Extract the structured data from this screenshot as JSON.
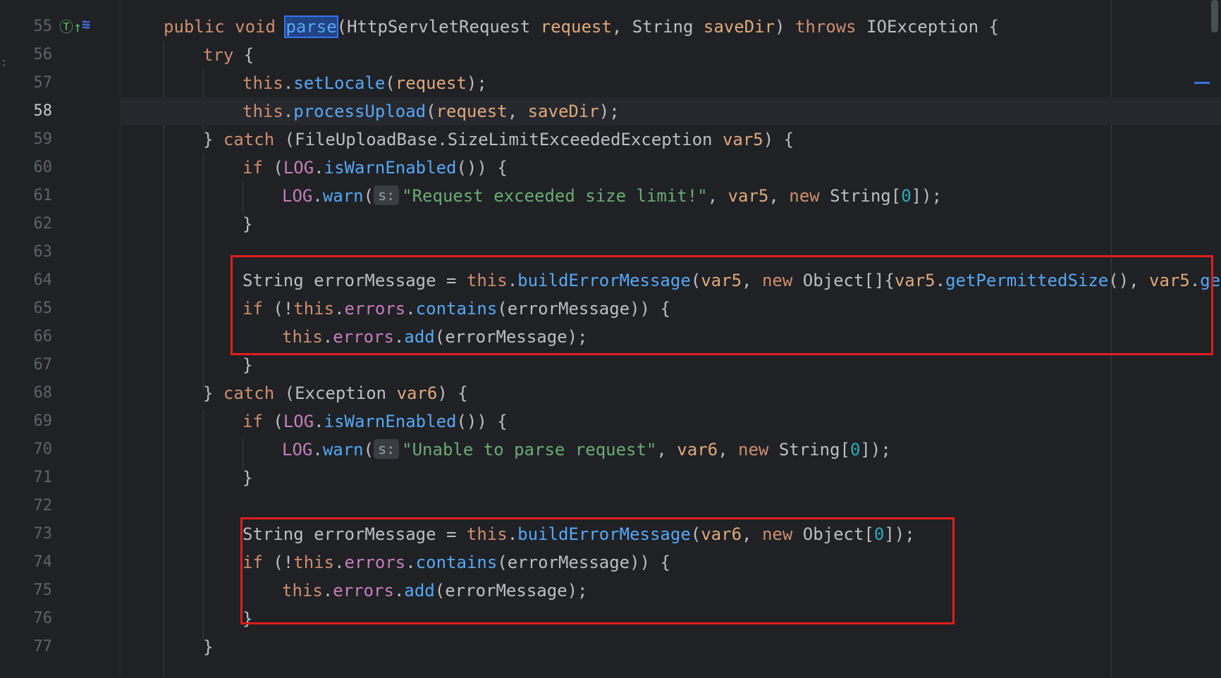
{
  "editor": {
    "colors": {
      "background": "#1f2125",
      "keyword": "#cf8e6d",
      "method": "#56a8f5",
      "string": "#6aab73",
      "field": "#c77dbb",
      "highlight": "#e21c1c"
    },
    "gutter_icons": {
      "implements": "implements-icon",
      "override": "override-icon"
    },
    "param_hint": "s:",
    "lines": [
      {
        "num": "55"
      },
      {
        "num": "56"
      },
      {
        "num": "57"
      },
      {
        "num": "58"
      },
      {
        "num": "59"
      },
      {
        "num": "60"
      },
      {
        "num": "61"
      },
      {
        "num": "62"
      },
      {
        "num": "63"
      },
      {
        "num": "64"
      },
      {
        "num": "65"
      },
      {
        "num": "66"
      },
      {
        "num": "67"
      },
      {
        "num": "68"
      },
      {
        "num": "69"
      },
      {
        "num": "70"
      },
      {
        "num": "71"
      },
      {
        "num": "72"
      },
      {
        "num": "73"
      },
      {
        "num": "74"
      },
      {
        "num": "75"
      },
      {
        "num": "76"
      },
      {
        "num": "77"
      }
    ],
    "code": {
      "l55": {
        "kw1": "public",
        "kw2": "void",
        "method": "parse",
        "type1": "HttpServletRequest",
        "p1": "request",
        "type2": "String",
        "p2": "saveDir",
        "kw3": "throws",
        "exc": "IOException",
        "tail": " {"
      },
      "l56": {
        "kw": "try",
        "tail": " {"
      },
      "l57": {
        "this": "this",
        "method": "setLocale",
        "arg": "request",
        "tail": ");"
      },
      "l58": {
        "this": "this",
        "method": "processUpload",
        "arg1": "request",
        "arg2": "saveDir",
        "tail": ");"
      },
      "l59": {
        "head": "} ",
        "kw": "catch",
        "type": "FileUploadBase.SizeLimitExceededException",
        "var": "var5",
        "tail": ") {"
      },
      "l60": {
        "kw": "if",
        "obj": "LOG",
        "method": "isWarnEnabled",
        "tail": "()) {"
      },
      "l61": {
        "obj": "LOG",
        "method": "warn",
        "str": "\"Request exceeded size limit!\"",
        "var": "var5",
        "kw": "new",
        "type": "String",
        "num": "0",
        "tail": "]);"
      },
      "l62": {
        "text": "}"
      },
      "l64": {
        "type": "String",
        "var": " errorMessage = ",
        "this": "this",
        "method": "buildErrorMessage",
        "arg": "var5",
        "kw": "new",
        "type2": "Object",
        "arg2": "var5",
        "method2": "getPermittedSize",
        "arg3": "var5",
        "method3": "getA"
      },
      "l65": {
        "kw": "if",
        "this": "this",
        "field": "errors",
        "method": "contains",
        "arg": "errorMessage",
        "tail": ")) {"
      },
      "l66": {
        "this": "this",
        "field": "errors",
        "method": "add",
        "arg": "errorMessage",
        "tail": ");"
      },
      "l67": {
        "text": "}"
      },
      "l68": {
        "head": "} ",
        "kw": "catch",
        "type": "Exception",
        "var": "var6",
        "tail": ") {"
      },
      "l69": {
        "kw": "if",
        "obj": "LOG",
        "method": "isWarnEnabled",
        "tail": "()) {"
      },
      "l70": {
        "obj": "LOG",
        "method": "warn",
        "str": "\"Unable to parse request\"",
        "var": "var6",
        "kw": "new",
        "type": "String",
        "num": "0",
        "tail": "]);"
      },
      "l71": {
        "text": "}"
      },
      "l73": {
        "type": "String",
        "var": " errorMessage = ",
        "this": "this",
        "method": "buildErrorMessage",
        "arg": "var6",
        "kw": "new",
        "type2": "Object",
        "num": "0",
        "tail": "]);"
      },
      "l74": {
        "kw": "if",
        "this": "this",
        "field": "errors",
        "method": "contains",
        "arg": "errorMessage",
        "tail": ")) {"
      },
      "l75": {
        "this": "this",
        "field": "errors",
        "method": "add",
        "arg": "errorMessage",
        "tail": ");"
      },
      "l76": {
        "text": "}"
      },
      "l77": {
        "text": "}"
      }
    }
  }
}
